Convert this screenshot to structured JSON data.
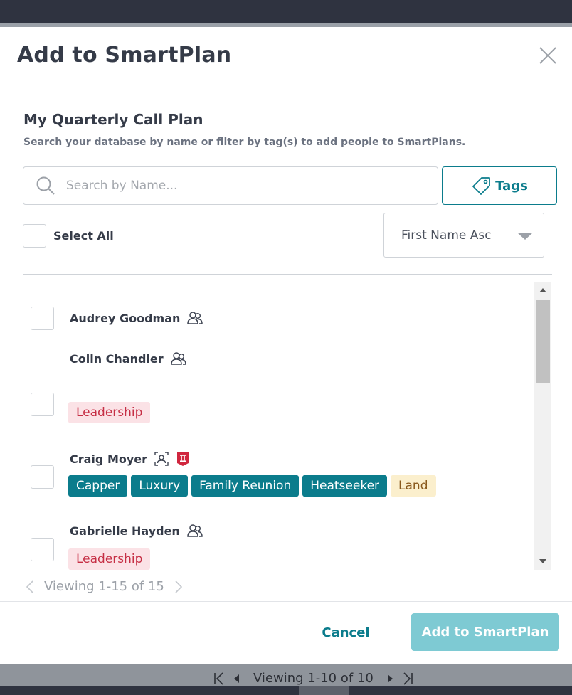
{
  "modal": {
    "title": "Add to SmartPlan",
    "plan_name": "My Quarterly Call Plan",
    "subtitle": "Search your database by name or filter by tag(s) to add people to SmartPlans."
  },
  "search": {
    "placeholder": "Search by Name..."
  },
  "tags_button": {
    "label": "Tags"
  },
  "select_all": {
    "label": "Select All"
  },
  "sort": {
    "value": "First Name Asc"
  },
  "contacts": [
    {
      "name": "Audrey Goodman",
      "icons": [
        "people-icon"
      ],
      "tags": []
    },
    {
      "name": "Colin Chandler",
      "icons": [
        "people-icon"
      ],
      "tags": [
        {
          "label": "Leadership",
          "style": "red"
        }
      ]
    },
    {
      "name": "Craig Moyer",
      "icons": [
        "contact-card-icon",
        "flag-badge-icon"
      ],
      "tags": [
        {
          "label": "Capper",
          "style": "teal"
        },
        {
          "label": "Luxury",
          "style": "teal"
        },
        {
          "label": "Family Reunion",
          "style": "teal"
        },
        {
          "label": "Heatseeker",
          "style": "teal"
        },
        {
          "label": "Land",
          "style": "sand"
        }
      ]
    },
    {
      "name": "Gabrielle Hayden",
      "icons": [
        "people-icon"
      ],
      "tags": [
        {
          "label": "Leadership",
          "style": "red"
        }
      ]
    }
  ],
  "pagination": {
    "text": "Viewing 1-15 of 15"
  },
  "footer": {
    "cancel_label": "Cancel",
    "add_label": "Add to SmartPlan"
  },
  "background": {
    "pager_text": "Viewing 1-10 of 10"
  },
  "colors": {
    "accent": "#0b7c8c",
    "primary_button": "#7ecad3",
    "tag_red_bg": "#fbe2e6",
    "tag_red_text": "#c62f45",
    "tag_sand_bg": "#fbefcd"
  }
}
